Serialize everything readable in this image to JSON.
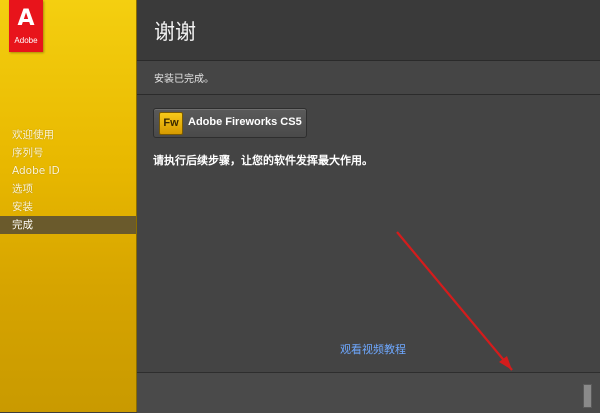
{
  "logo": {
    "mark": "A",
    "brand": "Adobe"
  },
  "sidebar": {
    "steps": [
      {
        "label": "欢迎使用",
        "active": false
      },
      {
        "label": "序列号",
        "active": false
      },
      {
        "label": "Adobe ID",
        "active": false
      },
      {
        "label": "选项",
        "active": false
      },
      {
        "label": "安装",
        "active": false
      },
      {
        "label": "完成",
        "active": true
      }
    ]
  },
  "header": {
    "title": "谢谢"
  },
  "subheader": {
    "text": "安装已完成。"
  },
  "product": {
    "icon_text": "Fw",
    "name": "Adobe Fireworks CS5"
  },
  "content": {
    "instruction": "请执行后续步骤，让您的软件发挥最大作用。",
    "video_link": "观看视频教程"
  },
  "colors": {
    "accent_yellow": "#e8b800",
    "adobe_red": "#e8141b",
    "link_blue": "#6ea8ff",
    "annotation_red": "#d41c1c"
  }
}
